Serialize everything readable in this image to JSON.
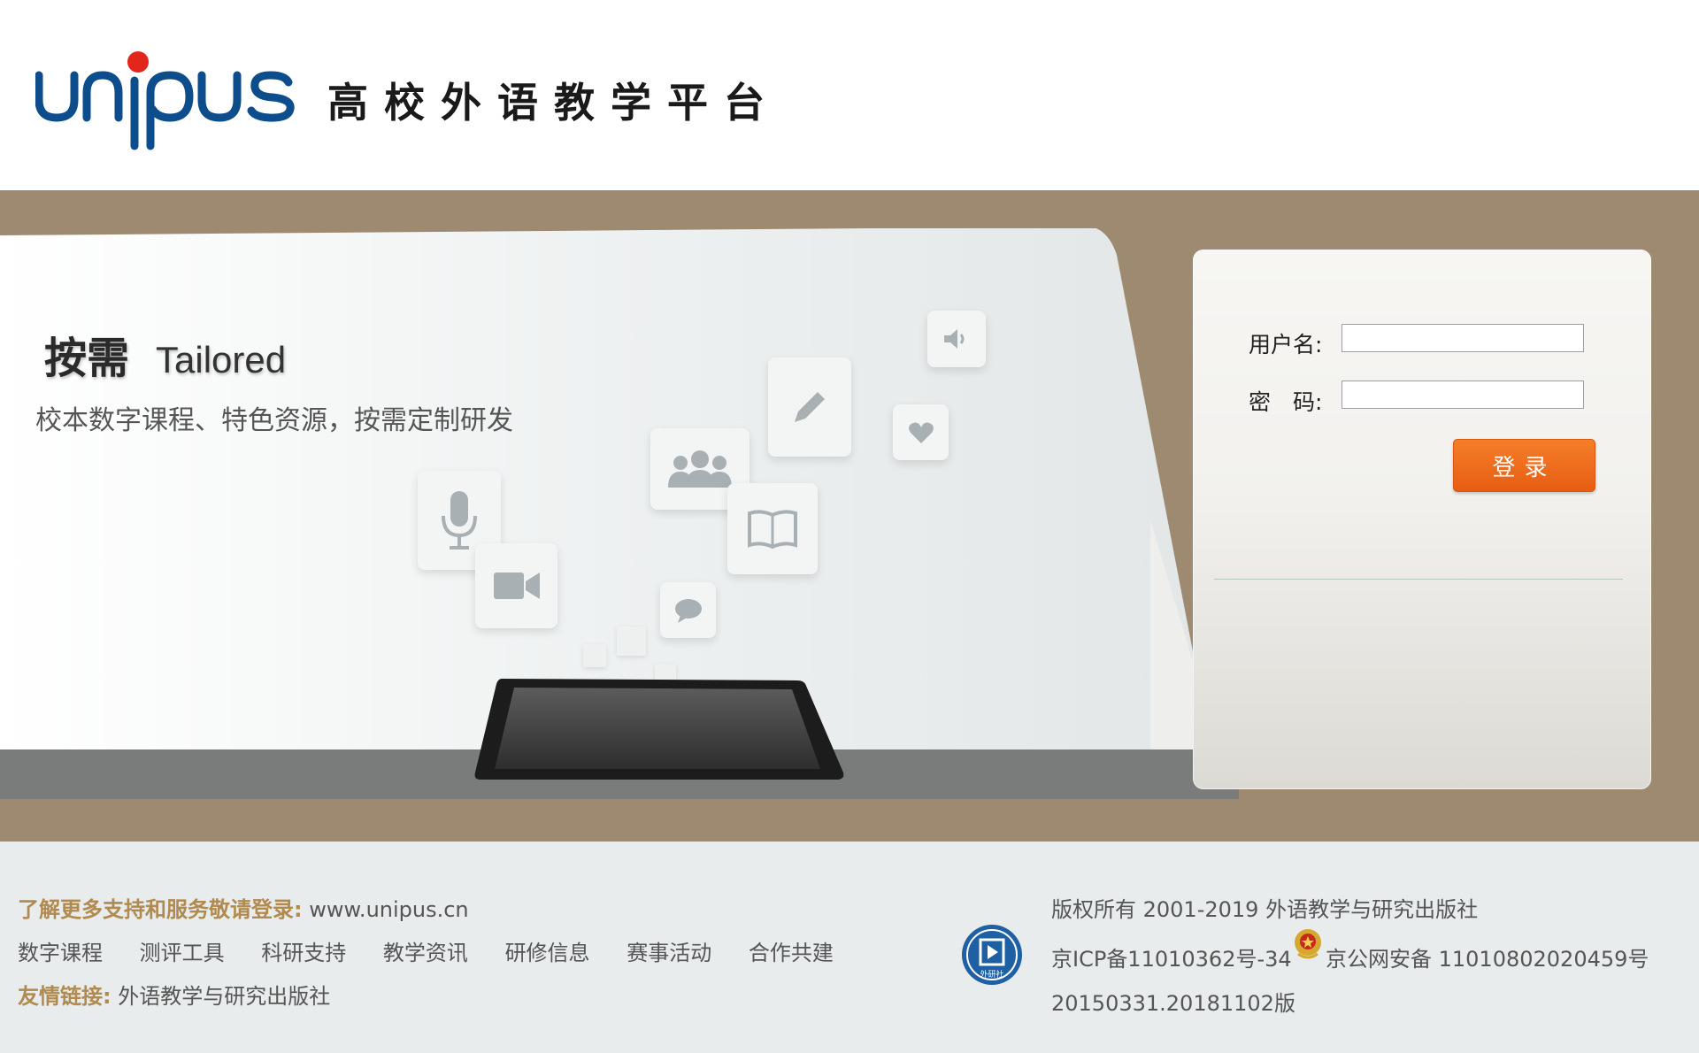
{
  "header": {
    "logo_text": "unipus",
    "title": "高校外语教学平台"
  },
  "banner": {
    "slogan_cn": "按需",
    "slogan_en": "Tailored",
    "subtitle": "校本数字课程、特色资源，按需定制研发"
  },
  "login": {
    "username_label": "用户名:",
    "password_label": "密　码:",
    "username_value": "",
    "password_value": "",
    "submit_label": "登录"
  },
  "footer": {
    "support_prefix": "了解更多支持和服务敬请登录:",
    "support_url": "www.unipus.cn",
    "nav": [
      "数字课程",
      "测评工具",
      "科研支持",
      "教学资讯",
      "研修信息",
      "赛事活动",
      "合作共建"
    ],
    "friend_label": "友情链接:",
    "friend_link": "外语教学与研究出版社",
    "copyright": "版权所有 2001-2019 外语教学与研究出版社",
    "icp": "京ICP备11010362号-34",
    "police": "京公网安备 11010802020459号",
    "version": "20150331.20181102版",
    "seal_text": "外研社"
  },
  "colors": {
    "band": "#9e8a70",
    "accent": "#e75d12",
    "footer_bg": "#e8ecec",
    "brand_blue": "#0d4d8c",
    "brand_red": "#e3261c"
  }
}
